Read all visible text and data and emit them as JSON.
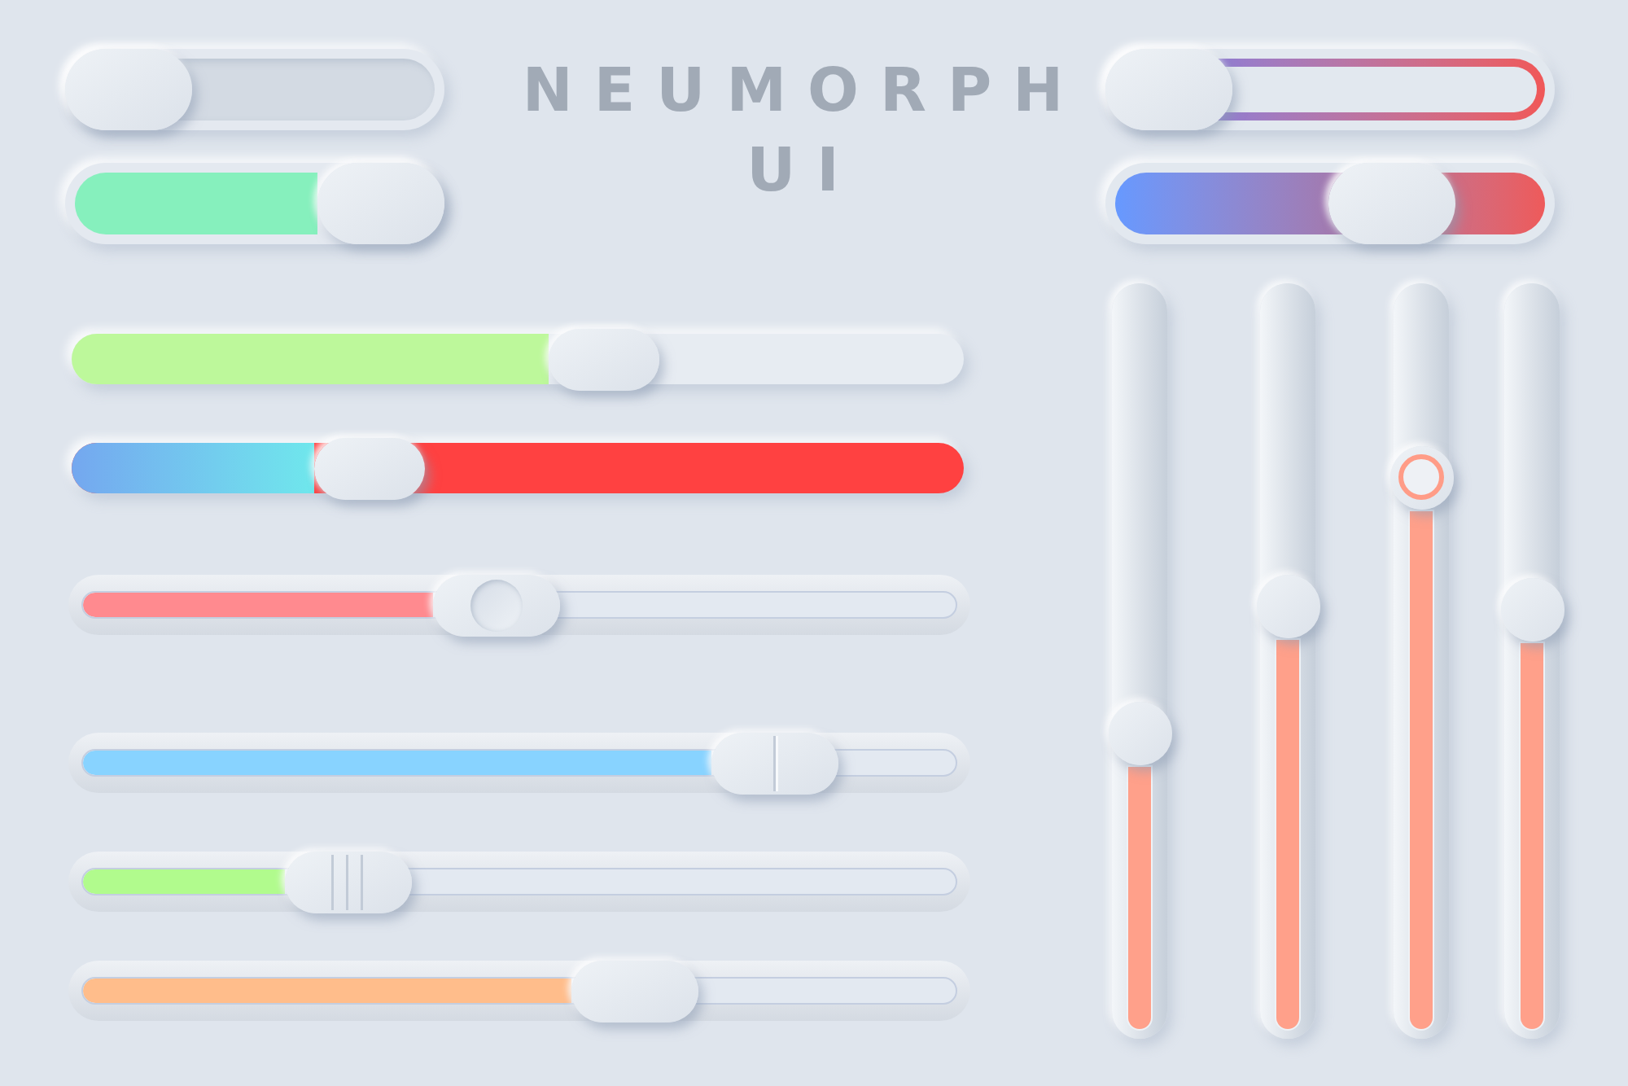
{
  "title": {
    "lines": [
      "NEUMORPH",
      "UI"
    ]
  },
  "toggles": [
    {
      "on": false
    },
    {
      "on": true
    }
  ],
  "gradient_sliders": [
    {
      "kind": "outline",
      "level": 0
    },
    {
      "kind": "fill",
      "level": 0.69
    }
  ],
  "sliders": [
    {
      "kind": "raised",
      "color": "#bdf89b",
      "level": 0.61
    },
    {
      "kind": "split",
      "color": "#ff4141",
      "level": 0.31
    },
    {
      "kind": "dimple",
      "color": "#ff8a8f",
      "level": 0.47
    },
    {
      "kind": "divider",
      "color": "#88d3ff",
      "level": 0.83
    },
    {
      "kind": "grip",
      "color": "#b1fb8d",
      "level": 0.28
    },
    {
      "kind": "plain",
      "color": "#ffbd8b",
      "level": 0.65
    }
  ],
  "vertical_sliders": [
    {
      "kind": "plain",
      "level": 0.395
    },
    {
      "kind": "plain",
      "level": 0.58
    },
    {
      "kind": "ring",
      "level": 0.765
    },
    {
      "kind": "plain",
      "level": 0.575
    }
  ]
}
